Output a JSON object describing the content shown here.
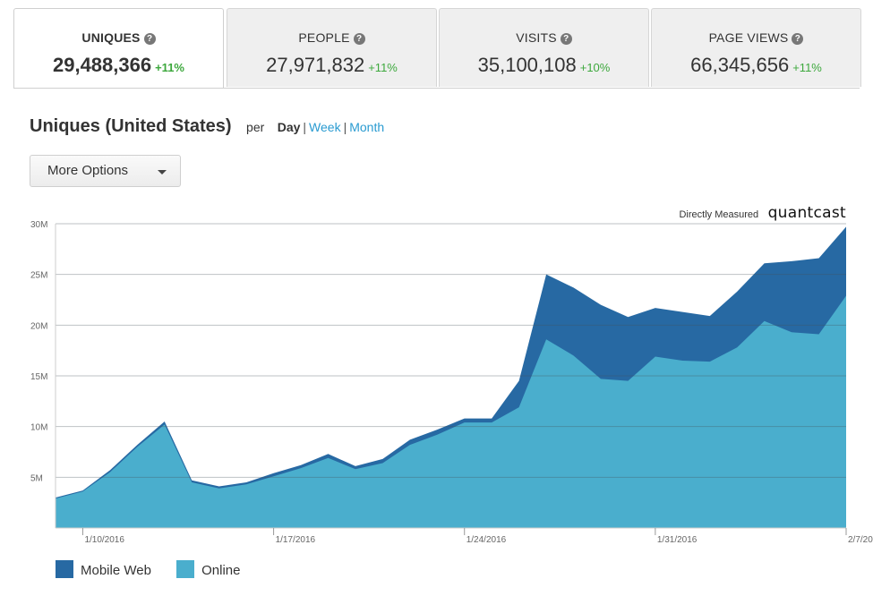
{
  "tabs": [
    {
      "label": "UNIQUES",
      "value": "29,488,366",
      "change": "+11%",
      "active": true
    },
    {
      "label": "PEOPLE",
      "value": "27,971,832",
      "change": "+11%",
      "active": false
    },
    {
      "label": "VISITS",
      "value": "35,100,108",
      "change": "+10%",
      "active": false
    },
    {
      "label": "PAGE VIEWS",
      "value": "66,345,656",
      "change": "+11%",
      "active": false
    }
  ],
  "header": {
    "title": "Uniques (United States)",
    "per_label": "per",
    "periods": {
      "day": "Day",
      "week": "Week",
      "month": "Month"
    },
    "separator": "|"
  },
  "more_options": {
    "label": "More Options"
  },
  "branding": {
    "directly_measured": "Directly Measured",
    "brand": "quantcast"
  },
  "colors": {
    "mobile_web": "#2769a3",
    "online": "#4aaecd",
    "positive_change": "#3da83d",
    "link": "#2a9bd1"
  },
  "chart_data": {
    "type": "area",
    "stacked": true,
    "x": [
      "2016-01-09",
      "2016-01-10",
      "2016-01-11",
      "2016-01-12",
      "2016-01-13",
      "2016-01-14",
      "2016-01-15",
      "2016-01-16",
      "2016-01-17",
      "2016-01-18",
      "2016-01-19",
      "2016-01-20",
      "2016-01-21",
      "2016-01-22",
      "2016-01-23",
      "2016-01-24",
      "2016-01-25",
      "2016-01-26",
      "2016-01-27",
      "2016-01-28",
      "2016-01-29",
      "2016-01-30",
      "2016-01-31",
      "2016-02-01",
      "2016-02-02",
      "2016-02-03",
      "2016-02-04",
      "2016-02-05",
      "2016-02-06",
      "2016-02-07"
    ],
    "x_tick_labels": [
      "1/10/2016",
      "1/17/2016",
      "1/24/2016",
      "1/31/2016",
      "2/7/20"
    ],
    "y_tick_labels": [
      "5M",
      "10M",
      "15M",
      "20M",
      "25M",
      "30M"
    ],
    "y_ticks": [
      5,
      10,
      15,
      20,
      25,
      30
    ],
    "ylim": [
      0,
      30
    ],
    "y_unit": "millions",
    "grid": true,
    "legend_position": "bottom-left",
    "series": [
      {
        "name": "Online",
        "color_key": "online",
        "values": [
          2.9,
          3.6,
          5.5,
          8.0,
          10.2,
          4.5,
          3.9,
          4.3,
          5.1,
          5.9,
          6.9,
          5.8,
          6.4,
          8.2,
          9.2,
          10.4,
          10.4,
          11.9,
          18.6,
          17.0,
          14.7,
          14.5,
          16.9,
          16.5,
          16.4,
          17.8,
          20.4,
          19.3,
          19.1,
          22.9
        ]
      },
      {
        "name": "Mobile Web",
        "color_key": "mobile_web",
        "values": [
          0.1,
          0.1,
          0.2,
          0.2,
          0.3,
          0.2,
          0.2,
          0.2,
          0.3,
          0.3,
          0.4,
          0.3,
          0.4,
          0.5,
          0.5,
          0.4,
          0.4,
          2.6,
          6.4,
          6.7,
          7.3,
          6.3,
          4.8,
          4.8,
          4.5,
          5.5,
          5.7,
          7.0,
          7.5,
          6.8
        ]
      }
    ]
  }
}
